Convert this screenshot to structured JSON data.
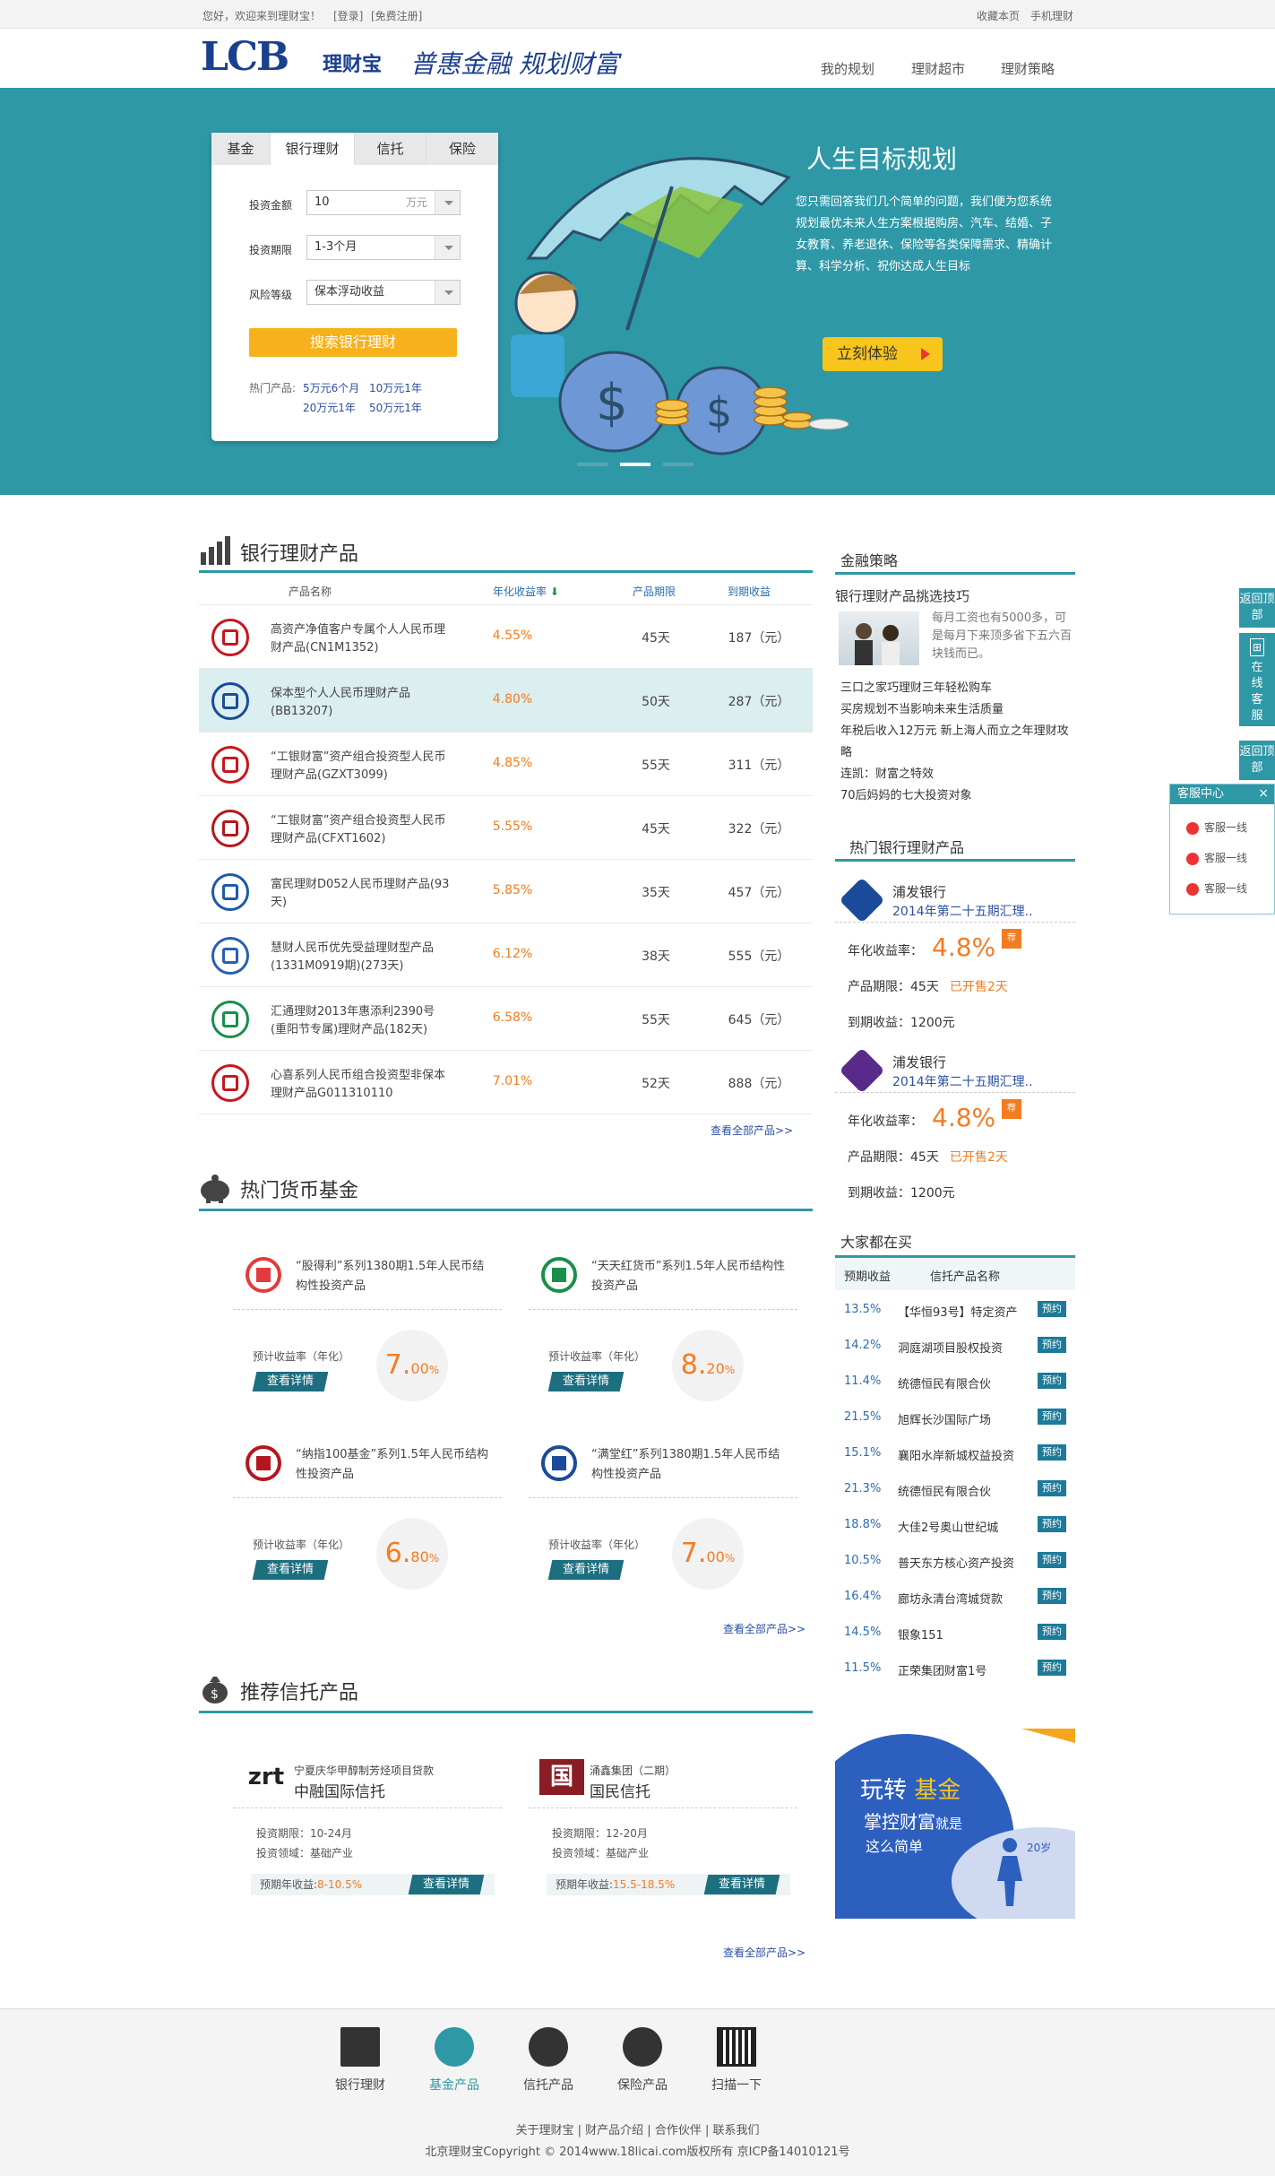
{
  "topbar": {
    "welcome": "您好，欢迎来到理财宝！",
    "login": "[登录]",
    "register": "[免费注册]",
    "bookmark": "收藏本页",
    "mobile": "手机理财"
  },
  "header": {
    "logo_text": "LCB",
    "brand": "理财宝",
    "slogan": "普惠金融  规划财富",
    "nav": [
      "我的规划",
      "理财超市",
      "理财策略"
    ]
  },
  "search_panel": {
    "tabs": [
      "基金",
      "银行理财",
      "信托",
      "保险"
    ],
    "active_tab": 1,
    "amount_label": "投资金额",
    "amount_value": "10",
    "amount_unit": "万元",
    "term_label": "投资期限",
    "term_value": "1-3个月",
    "risk_label": "风险等级",
    "risk_value": "保本浮动收益",
    "search_button": "搜索银行理财",
    "hot_label": "热门产品:",
    "hot_links": [
      "5万元6个月",
      "10万元1年",
      "20万元1年",
      "50万元1年"
    ]
  },
  "banner": {
    "title": "人生目标规划",
    "description": "您只需回答我们几个简单的问题，我们便为您系统规划最优未来人生方案根据购房、汽车、结婚、子女教育、养老退休、保险等各类保障需求、精确计算、科学分析、祝你达成人生目标",
    "cta": "立刻体验"
  },
  "bank_products": {
    "title": "银行理财产品",
    "columns": [
      "产品名称",
      "年化收益率",
      "产品期限",
      "到期收益"
    ],
    "rows": [
      {
        "name": "高资产净值客户专属个人人民币理财产品(CN1M1352)",
        "rate": "4.55%",
        "term": "45天",
        "return": "187（元）",
        "logo_color": "#c8161d"
      },
      {
        "name": "保本型个人人民币理财产品(BB13207)",
        "rate": "4.80%",
        "term": "50天",
        "return": "287（元）",
        "logo_color": "#1a4b9b"
      },
      {
        "name": "“工银财富”资产组合投资型人民币理财产品(GZXT3099)",
        "rate": "4.85%",
        "term": "55天",
        "return": "311（元）",
        "logo_color": "#c8161d"
      },
      {
        "name": "“工银财富”资产组合投资型人民币理财产品(CFXT1602)",
        "rate": "5.55%",
        "term": "45天",
        "return": "322（元）",
        "logo_color": "#b3171d"
      },
      {
        "name": "富民理财D052人民币理财产品(93天)",
        "rate": "5.85%",
        "term": "35天",
        "return": "457（元）",
        "logo_color": "#1e5aa8"
      },
      {
        "name": "慧财人民币优先受益理财型产品(1331M0919期)(273天)",
        "rate": "6.12%",
        "term": "38天",
        "return": "555（元）",
        "logo_color": "#2a5fb0"
      },
      {
        "name": "汇通理财2013年惠添利2390号(重阳节专属)理财产品(182天)",
        "rate": "6.58%",
        "term": "55天",
        "return": "645（元）",
        "logo_color": "#1a8f4a"
      },
      {
        "name": "心喜系列人民币组合投资型非保本理财产品G011310110",
        "rate": "7.01%",
        "term": "52天",
        "return": "888（元）",
        "logo_color": "#c8161d"
      }
    ],
    "more": "查看全部产品>>"
  },
  "funds": {
    "title": "热门货币基金",
    "rate_label": "预计收益率（年化）",
    "detail_btn": "查看详情",
    "items": [
      {
        "name": "“股得利”系列1380期1.5年人民币结构性投资产品",
        "rate": "7.",
        "rate_dec": "00",
        "logo_color": "#e33b3b"
      },
      {
        "name": "“天天红货币”系列1.5年人民币结构性投资产品",
        "rate": "8.",
        "rate_dec": "20",
        "logo_color": "#1a8f4a"
      },
      {
        "name": "“纳指100基金”系列1.5年人民币结构性投资产品",
        "rate": "6.",
        "rate_dec": "80",
        "logo_color": "#b3171d"
      },
      {
        "name": "“满堂红”系列1380期1.5年人民币结构性投资产品",
        "rate": "7.",
        "rate_dec": "00",
        "logo_color": "#1a4b9b"
      }
    ],
    "percent": "%",
    "more": "查看全部产品>>"
  },
  "trusts": {
    "title": "推荐信托产品",
    "items": [
      {
        "project": "宁夏庆华甲醇制芳烃项目贷款",
        "company": "中融国际信托",
        "period_label": "投资期限：",
        "period": "10-24月",
        "field_label": "投资领域：",
        "field": "基础产业",
        "yield_label": "预期年收益:",
        "yield": "8-10.5%",
        "logo": "zrt"
      },
      {
        "project": "涌鑫集团（二期）",
        "company": "国民信托",
        "period_label": "投资期限：",
        "period": "12-20月",
        "field_label": "投资领域：",
        "field": "基础产业",
        "yield_label": "预期年收益:",
        "yield": "15.5-18.5%",
        "logo": "国"
      }
    ],
    "detail_btn": "查看详情",
    "more": "查看全部产品>>"
  },
  "sidebar": {
    "strategy_title": "金融策略",
    "strategy_headline": "银行理财产品挑选技巧",
    "strategy_summary": "每月工资也有5000多，可是每月下来顶多省下五六百块钱而已。",
    "strategy_links": [
      "三口之家巧理财三年轻松购车",
      "买房规划不当影响未来生活质量",
      "年税后收入12万元 新上海人而立之年理财攻略",
      "连凯：财富之特效",
      "70后妈妈的七大投资对象"
    ],
    "hot_title": "热门银行理财产品",
    "hot_items": [
      {
        "bank": "浦发银行",
        "name": "2014年第二十五期汇理..",
        "rate_label": "年化收益率：",
        "rate": "4.8%",
        "term_label": "产品期限：",
        "term": "45天",
        "status": "已开售2天",
        "return_label": "到期收益：",
        "return": "1200元",
        "badge": "荐"
      },
      {
        "bank": "浦发银行",
        "name": "2014年第二十五期汇理..",
        "rate_label": "年化收益率：",
        "rate": "4.8%",
        "term_label": "产品期限：",
        "term": "45天",
        "status": "已开售2天",
        "return_label": "到期收益：",
        "return": "1200元",
        "badge": "荐"
      }
    ],
    "buying_title": "大家都在买",
    "buying_cols": [
      "预期收益",
      "信托产品名称"
    ],
    "buying_btn": "预约",
    "buying_rows": [
      {
        "rate": "13.5%",
        "name": "【华恒93号】特定资产"
      },
      {
        "rate": "14.2%",
        "name": "洞庭湖项目股权投资"
      },
      {
        "rate": "11.4%",
        "name": "统德恒民有限合伙"
      },
      {
        "rate": "21.5%",
        "name": "旭辉长沙国际广场"
      },
      {
        "rate": "15.1%",
        "name": "襄阳水岸新城权益投资"
      },
      {
        "rate": "21.3%",
        "name": "统德恒民有限合伙"
      },
      {
        "rate": "18.8%",
        "name": "大佳2号奥山世纪城"
      },
      {
        "rate": "10.5%",
        "name": "普天东方核心资产投资"
      },
      {
        "rate": "16.4%",
        "name": "廊坊永清台湾城贷款"
      },
      {
        "rate": "14.5%",
        "name": "银象151"
      },
      {
        "rate": "11.5%",
        "name": "正荣集团财富1号"
      }
    ],
    "promo_line1a": "玩转",
    "promo_line1b": "基金",
    "promo_line2a": "掌控财富",
    "promo_line2b": "就是",
    "promo_line3": "这么简单",
    "promo_age": "20岁"
  },
  "float": {
    "back_top": "返回顶部",
    "online": "在线客服",
    "back_top2": "返回顶部",
    "service_title": "客服中心",
    "service_items": [
      "客服一线",
      "客服一线",
      "客服一线"
    ],
    "close": "×"
  },
  "footer": {
    "icons": [
      "银行理财",
      "基金产品",
      "信托产品",
      "保险产品",
      "扫描一下"
    ],
    "links": "关于理财宝 | 财产品介绍 | 合作伙伴 | 联系我们",
    "copyright": "北京理财宝Copyright © 2014www.18licai.com版权所有 京ICP备14010121号"
  }
}
